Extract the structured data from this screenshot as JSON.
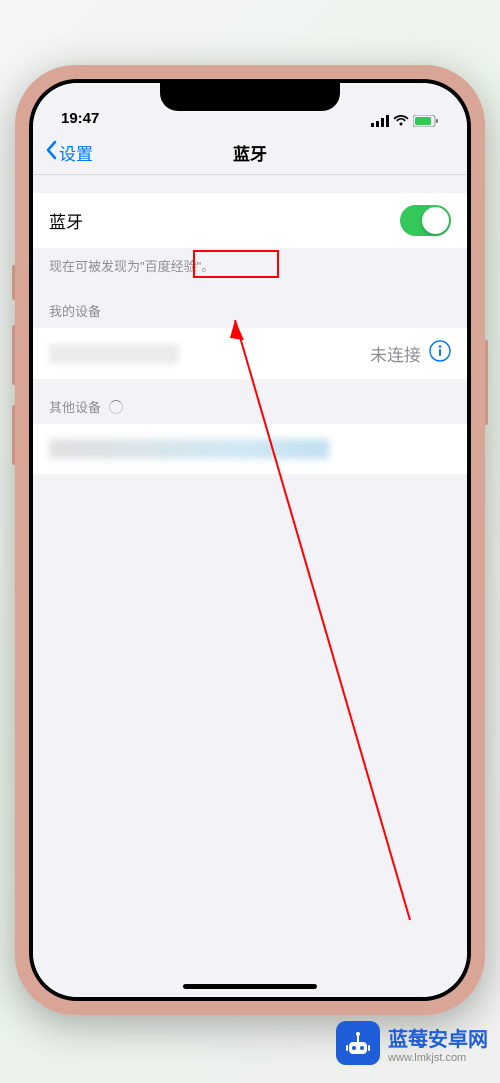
{
  "status_bar": {
    "time": "19:47"
  },
  "nav": {
    "back_label": "设置",
    "title": "蓝牙"
  },
  "bluetooth_toggle": {
    "label": "蓝牙",
    "enabled": true
  },
  "discoverable": {
    "prefix": "现在可被发现为",
    "device_name": "\"百度经验\"",
    "suffix": "。"
  },
  "sections": {
    "my_devices": "我的设备",
    "other_devices": "其他设备"
  },
  "my_device": {
    "status": "未连接"
  },
  "watermark": {
    "title": "蓝莓安卓网",
    "url": "www.lmkjst.com"
  }
}
